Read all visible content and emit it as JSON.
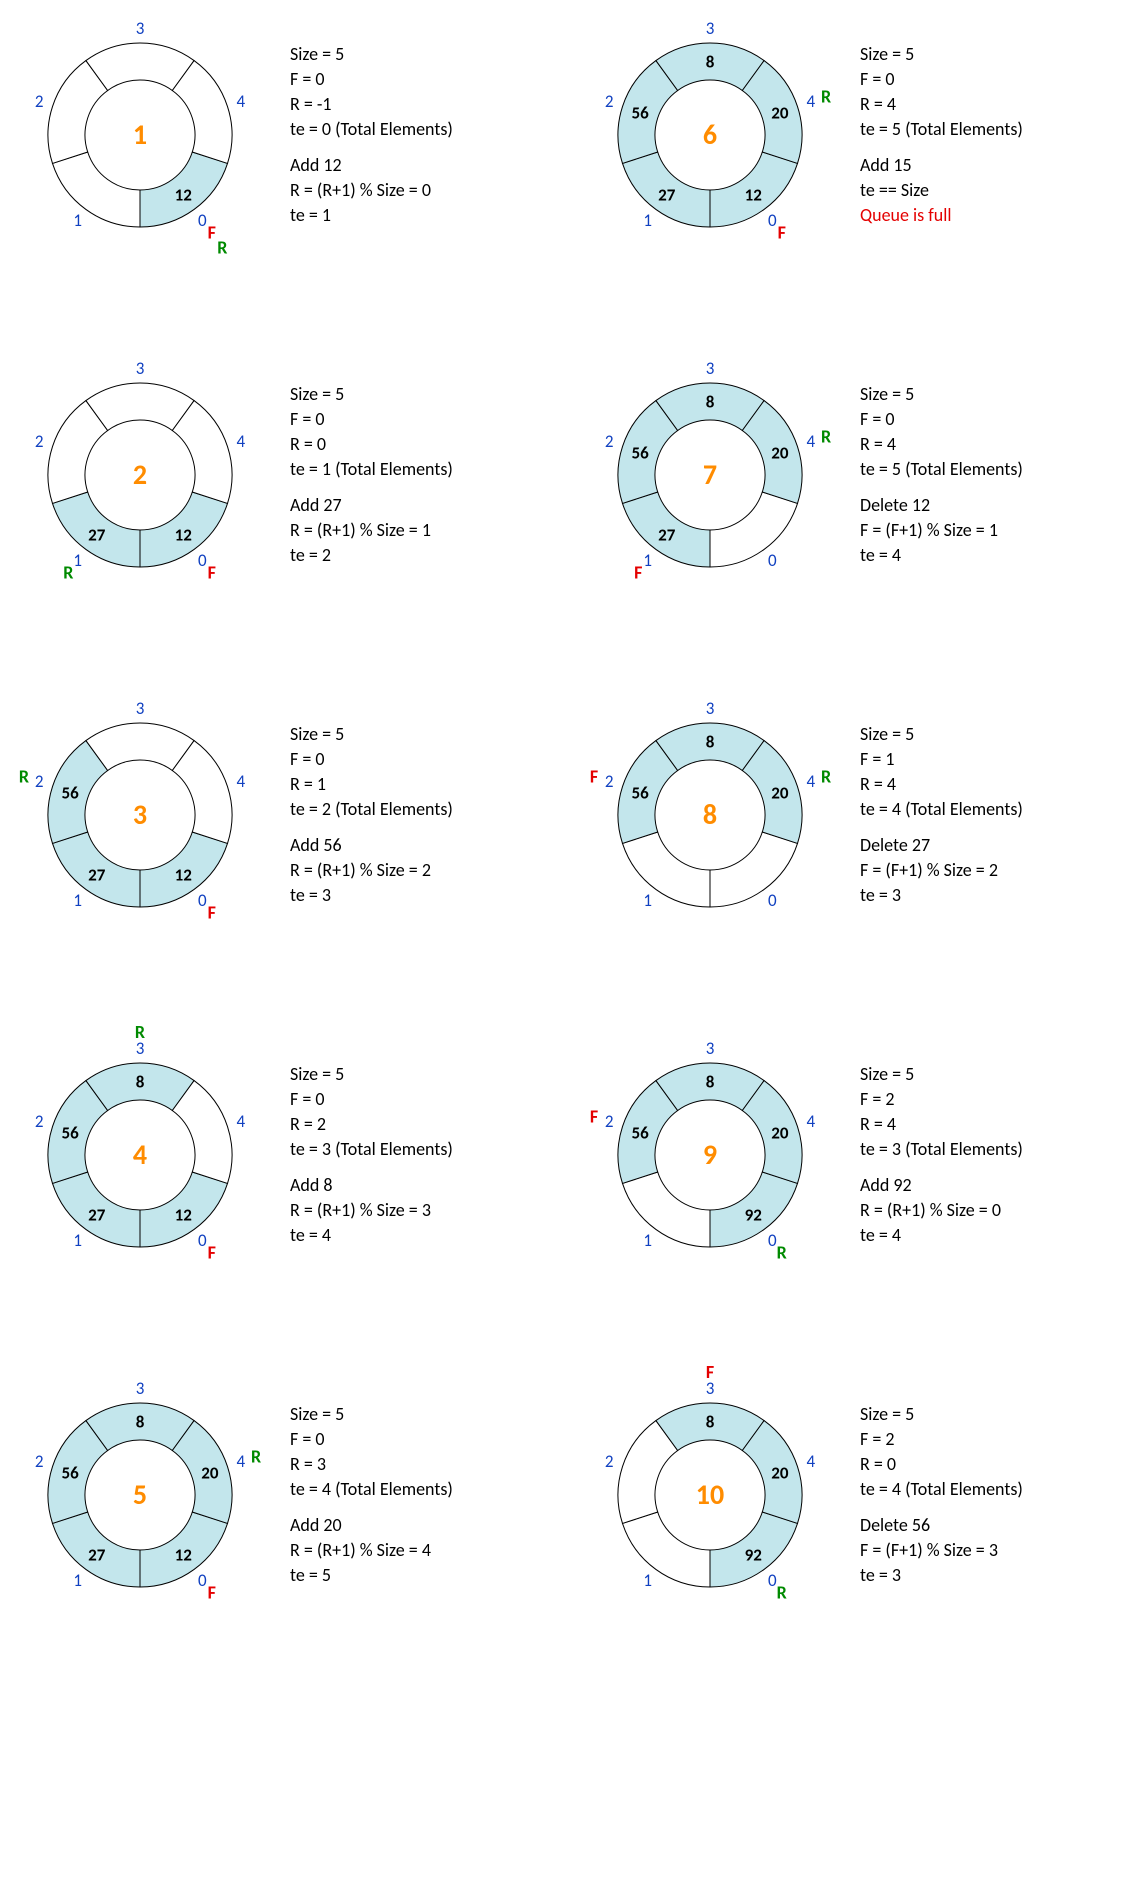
{
  "fill": "#c3e6ec",
  "steps": [
    {
      "num": "1",
      "F": 0,
      "R_ptr": 0,
      "R_same": true,
      "block1": [
        "Size = 5",
        "F = 0",
        "R = -1",
        "te = 0  (Total Elements)"
      ],
      "block2": [
        "Add 12",
        "R = (R+1) % Size = 0",
        "te = 1"
      ],
      "cells": [
        "12",
        "",
        "",
        "",
        ""
      ],
      "filled": [
        true,
        false,
        false,
        false,
        false
      ]
    },
    {
      "num": "2",
      "F": 0,
      "R_ptr": 1,
      "block1": [
        "Size = 5",
        "F = 0",
        "R = 0",
        "te = 1  (Total Elements)"
      ],
      "block2": [
        "Add 27",
        "R = (R+1) % Size = 1",
        "te = 2"
      ],
      "cells": [
        "12",
        "27",
        "",
        "",
        ""
      ],
      "filled": [
        true,
        true,
        false,
        false,
        false
      ]
    },
    {
      "num": "3",
      "F": 0,
      "R_ptr": 2,
      "block1": [
        "Size = 5",
        "F = 0",
        "R = 1",
        "te = 2  (Total Elements)"
      ],
      "block2": [
        "Add 56",
        "R = (R+1) % Size = 2",
        "te = 3"
      ],
      "cells": [
        "12",
        "27",
        "56",
        "",
        ""
      ],
      "filled": [
        true,
        true,
        true,
        false,
        false
      ]
    },
    {
      "num": "4",
      "F": 0,
      "R_ptr": 3,
      "block1": [
        "Size = 5",
        "F = 0",
        "R = 2",
        "te = 3  (Total Elements)"
      ],
      "block2": [
        "Add 8",
        "R = (R+1) % Size = 3",
        "te = 4"
      ],
      "cells": [
        "12",
        "27",
        "56",
        "8",
        ""
      ],
      "filled": [
        true,
        true,
        true,
        true,
        false
      ]
    },
    {
      "num": "5",
      "F": 0,
      "R_ptr": 4,
      "block1": [
        "Size = 5",
        "F = 0",
        "R = 3",
        "te = 4  (Total Elements)"
      ],
      "block2": [
        "Add 20",
        "R = (R+1) % Size = 4",
        "te = 5"
      ],
      "cells": [
        "12",
        "27",
        "56",
        "8",
        "20"
      ],
      "filled": [
        true,
        true,
        true,
        true,
        true
      ]
    },
    {
      "num": "6",
      "F": 0,
      "R_ptr": 4,
      "block1": [
        "Size = 5",
        "F = 0",
        "R = 4",
        "te = 5  (Total Elements)"
      ],
      "block2": [
        "Add 15",
        "te == Size"
      ],
      "block2_red": [
        "Queue is full"
      ],
      "cells": [
        "12",
        "27",
        "56",
        "8",
        "20"
      ],
      "filled": [
        true,
        true,
        true,
        true,
        true
      ]
    },
    {
      "num": "7",
      "F": 1,
      "R_ptr": 4,
      "block1": [
        "Size = 5",
        "F = 0",
        "R = 4",
        "te = 5  (Total Elements)"
      ],
      "block2": [
        "Delete 12",
        "F = (F+1) % Size = 1",
        "te = 4"
      ],
      "cells": [
        "",
        "27",
        "56",
        "8",
        "20"
      ],
      "filled": [
        false,
        true,
        true,
        true,
        true
      ]
    },
    {
      "num": "8",
      "F": 2,
      "R_ptr": 4,
      "block1": [
        "Size = 5",
        "F = 1",
        "R = 4",
        "te = 4  (Total Elements)"
      ],
      "block2": [
        "Delete 27",
        "F = (F+1) % Size = 2",
        "te = 3"
      ],
      "cells": [
        "",
        "",
        "56",
        "8",
        "20"
      ],
      "filled": [
        false,
        false,
        true,
        true,
        true
      ]
    },
    {
      "num": "9",
      "F": 2,
      "R_ptr": 0,
      "block1": [
        "Size = 5",
        "F = 2",
        "R = 4",
        "te = 3  (Total Elements)"
      ],
      "block2": [
        "Add 92",
        "R = (R+1) % Size = 0",
        "te = 4"
      ],
      "cells": [
        "92",
        "",
        "56",
        "8",
        "20"
      ],
      "filled": [
        true,
        false,
        true,
        true,
        true
      ]
    },
    {
      "num": "10",
      "F": 3,
      "R_ptr": 0,
      "block1": [
        "Size = 5",
        "F = 2",
        "R = 0",
        "te = 4  (Total Elements)"
      ],
      "block2": [
        "Delete 56",
        "F = (F+1) % Size = 3",
        "te = 3"
      ],
      "cells": [
        "92",
        "",
        "",
        "8",
        "20"
      ],
      "filled": [
        true,
        false,
        false,
        true,
        true
      ]
    }
  ]
}
